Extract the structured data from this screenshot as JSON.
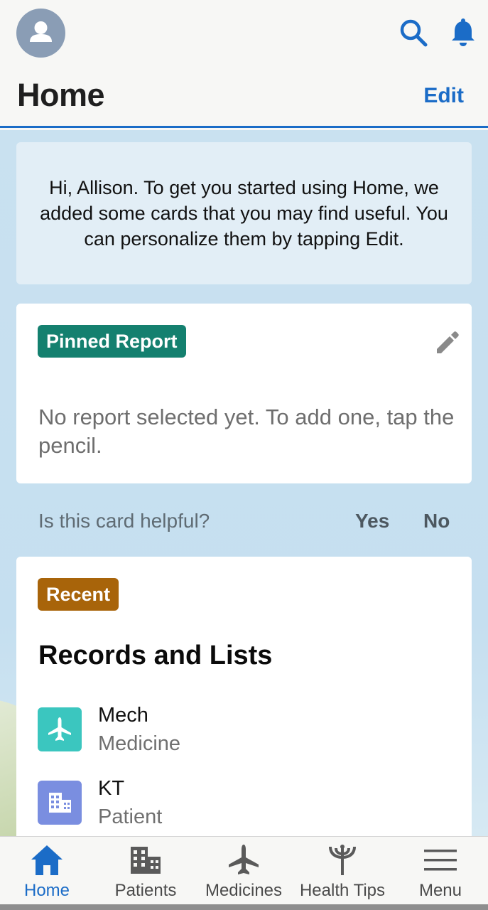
{
  "header": {
    "title": "Home",
    "edit_label": "Edit",
    "icons": {
      "avatar": "user-avatar-icon",
      "search": "search-icon",
      "notifications": "bell-icon"
    },
    "accent_color": "#1b6cc7"
  },
  "welcome": {
    "message": "Hi, Allison. To get you started using Home, we added some cards that you may find useful. You can personalize them by tapping Edit."
  },
  "pinned_card": {
    "badge": "Pinned Report",
    "badge_color": "#14806f",
    "empty_message": "No report selected yet. To add one, tap the pencil.",
    "edit_icon": "pencil-icon"
  },
  "feedback": {
    "question": "Is this card helpful?",
    "yes_label": "Yes",
    "no_label": "No"
  },
  "recent_card": {
    "badge": "Recent",
    "badge_color": "#a8640a",
    "title": "Records and Lists",
    "items": [
      {
        "name": "Mech",
        "type": "Medicine",
        "icon": "airplane-icon",
        "icon_color": "#3bc6bf"
      },
      {
        "name": "KT",
        "type": "Patient",
        "icon": "building-icon",
        "icon_color": "#7a8ee0"
      }
    ]
  },
  "bottom_nav": {
    "items": [
      {
        "label": "Home",
        "icon": "home-icon",
        "active": true
      },
      {
        "label": "Patients",
        "icon": "building-icon",
        "active": false
      },
      {
        "label": "Medicines",
        "icon": "airplane-icon",
        "active": false
      },
      {
        "label": "Health Tips",
        "icon": "caduceus-icon",
        "active": false
      },
      {
        "label": "Menu",
        "icon": "hamburger-menu-icon",
        "active": false
      }
    ]
  }
}
